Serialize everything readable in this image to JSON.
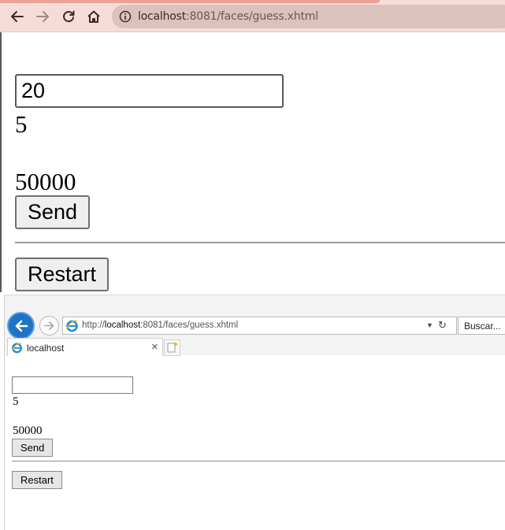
{
  "chrome": {
    "url_host": "localhost",
    "url_rest": ":8081/faces/guess.xhtml",
    "icons": [
      "back-arrow-icon",
      "forward-arrow-icon",
      "reload-icon",
      "home-icon",
      "info-icon"
    ]
  },
  "page": {
    "input_value": "20",
    "line_1": "5",
    "line_2": "50000",
    "send_label": "Send",
    "restart_label": "Restart"
  },
  "ie": {
    "url_prefix": "http://",
    "url_host": "localhost",
    "url_rest": ":8081/faces/guess.xhtml",
    "search_label": "Buscar...",
    "tab_title": "localhost",
    "tab_close": "×",
    "input_value": "",
    "line_1": "5",
    "line_2": "50000",
    "send_label": "Send",
    "restart_label": "Restart"
  }
}
